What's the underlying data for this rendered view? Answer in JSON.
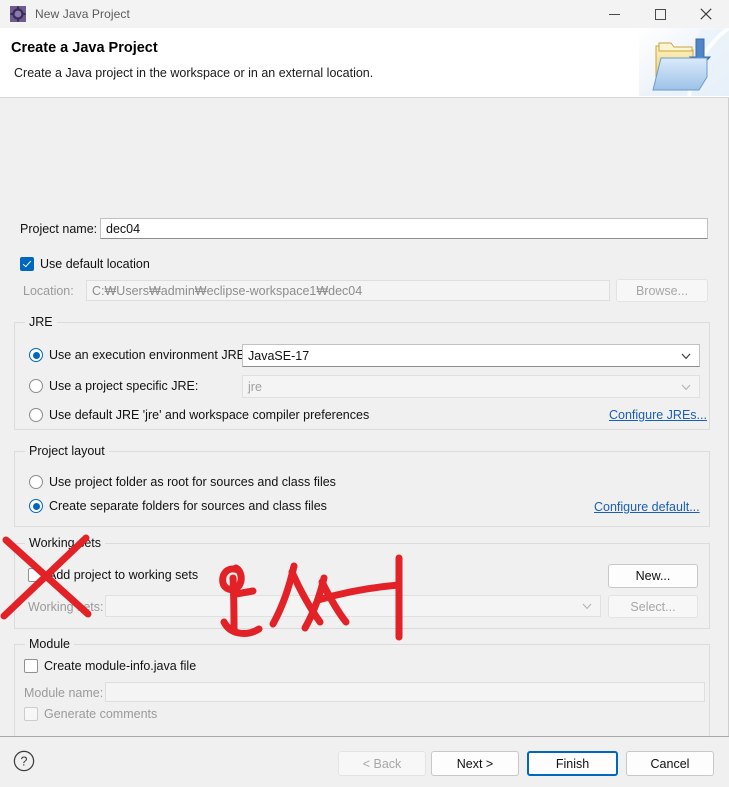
{
  "window": {
    "title": "New Java Project",
    "icon": "eclipse-wizard-icon",
    "controls": {
      "minimize": "minimize-icon",
      "maximize": "maximize-icon",
      "close": "close-icon"
    }
  },
  "header": {
    "title": "Create a Java Project",
    "subtitle": "Create a Java project in the workspace or in an external location.",
    "banner_icon": "new-java-project-folder-icon"
  },
  "form": {
    "project_name_label": "Project name:",
    "project_name_value": "dec04",
    "use_default_location_label": "Use default location",
    "use_default_location_checked": true,
    "location_label": "Location:",
    "location_value": "C:₩Users₩admin₩eclipse-workspace1₩dec04",
    "location_enabled": false,
    "browse_label": "Browse...",
    "browse_enabled": false
  },
  "jre": {
    "group_title": "JRE",
    "execution_env_label": "Use an execution environment JRE:",
    "execution_env_selected": true,
    "execution_env_value": "JavaSE-17",
    "project_specific_label": "Use a project specific JRE:",
    "project_specific_selected": false,
    "project_specific_value": "jre",
    "default_jre_label": "Use default JRE 'jre' and workspace compiler preferences",
    "default_jre_selected": false,
    "configure_link": "Configure JREs..."
  },
  "project_layout": {
    "group_title": "Project layout",
    "root_folder_label": "Use project folder as root for sources and class files",
    "root_folder_selected": false,
    "separate_folders_label": "Create separate folders for sources and class files",
    "separate_folders_selected": true,
    "configure_link": "Configure default..."
  },
  "working_sets": {
    "group_title": "Working sets",
    "add_project_label": "Add project to working sets",
    "add_project_checked": false,
    "new_button": "New...",
    "new_enabled": true,
    "working_sets_label": "Working sets:",
    "working_sets_value": "",
    "select_button": "Select...",
    "select_enabled": false
  },
  "module": {
    "group_title": "Module",
    "create_module_info_label": "Create module-info.java file",
    "create_module_info_checked": false,
    "module_name_label": "Module name:",
    "module_name_value": "",
    "generate_comments_label": "Generate comments",
    "generate_comments_checked": false
  },
  "footer": {
    "help_icon": "help-question-icon",
    "back_button": "< Back",
    "back_enabled": false,
    "next_button": "Next >",
    "next_enabled": true,
    "finish_button": "Finish",
    "finish_default": true,
    "cancel_button": "Cancel"
  },
  "annotation": {
    "handwritten_text": "안 써",
    "meaning_note": "cross-out over Module section",
    "color": "#e32227"
  }
}
